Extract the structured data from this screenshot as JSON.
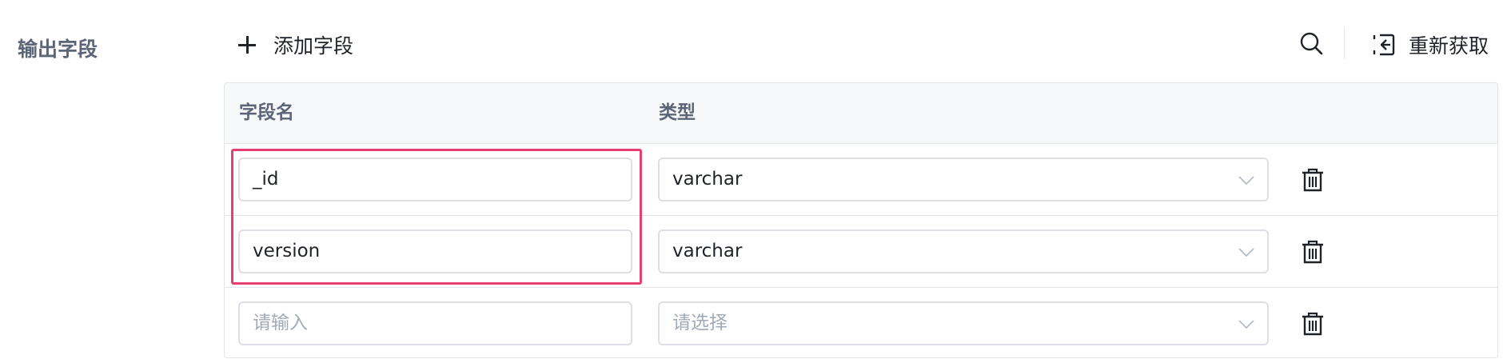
{
  "section": {
    "label": "输出字段"
  },
  "toolbar": {
    "add_field_label": "添加字段",
    "refetch_label": "重新获取",
    "search_icon": "search-icon",
    "refetch_icon": "refresh-back-icon"
  },
  "table": {
    "headers": {
      "name": "字段名",
      "type": "类型"
    },
    "rows": [
      {
        "name": "_id",
        "type": "varchar"
      },
      {
        "name": "version",
        "type": "varchar"
      },
      {
        "name_placeholder": "请输入",
        "type_placeholder": "请选择"
      }
    ]
  },
  "colors": {
    "highlight": "#e83d6f",
    "border": "#dcdfe6",
    "header_bg": "#f7f8fa",
    "placeholder": "#a3abb8"
  }
}
